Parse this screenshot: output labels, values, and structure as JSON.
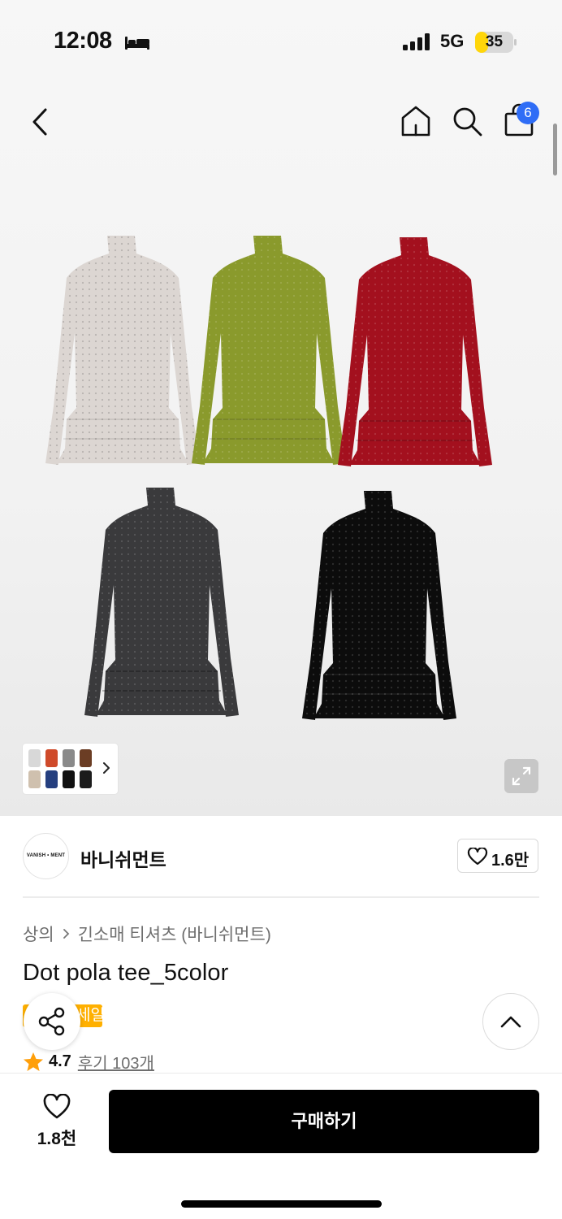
{
  "status_bar": {
    "time": "12:08",
    "network": "5G",
    "battery": "35",
    "battery_level": 0.35
  },
  "header": {
    "cart_count": "6",
    "icons": [
      "back-icon",
      "home-icon",
      "search-icon",
      "cart-icon"
    ]
  },
  "gallery": {
    "product_colors": [
      "#dcd6d2",
      "#8a9a2c",
      "#a3101e",
      "#3a3a3c",
      "#0c0c0c"
    ],
    "thumbnail_colors": [
      "#d8d8d8",
      "#cf4a2a",
      "#8a8a8a",
      "#6b3d24",
      "#cfc0ae",
      "#253f7f",
      "#111111",
      "#1c1c1c"
    ]
  },
  "brand": {
    "logo_text": "VANISH • MENT",
    "name": "바니쉬먼트",
    "like_count": "1.6만"
  },
  "product": {
    "breadcrumb": [
      "상의",
      "긴소매 티셔츠 (바니쉬먼트)"
    ],
    "title": "Dot pola tee_5color",
    "sale_badge": "세일",
    "rating": "4.7",
    "review_link": "후기 103개"
  },
  "bottom_bar": {
    "wish_count": "1.8천",
    "buy_label": "구매하기"
  },
  "colors": {
    "accent_blue": "#2f6df6",
    "sale_yellow": "#ffb000",
    "star_orange": "#ff9f0a",
    "buy_black": "#000000"
  }
}
